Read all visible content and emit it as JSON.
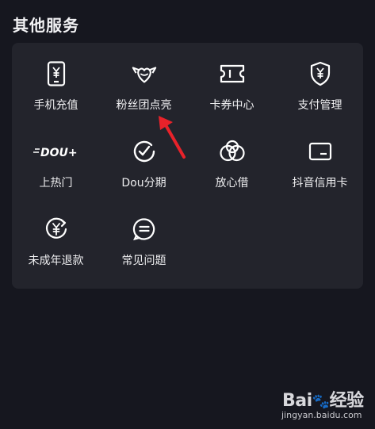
{
  "section": {
    "title": "其他服务"
  },
  "services": [
    {
      "label": "手机充值",
      "icon": "phone-recharge-icon"
    },
    {
      "label": "粉丝团点亮",
      "icon": "fan-club-icon"
    },
    {
      "label": "卡券中心",
      "icon": "coupon-icon"
    },
    {
      "label": "支付管理",
      "icon": "payment-shield-icon"
    },
    {
      "label": "上热门",
      "icon": "dou-plus-icon",
      "badge_text": "DOU+"
    },
    {
      "label": "Dou分期",
      "icon": "installment-icon"
    },
    {
      "label": "放心借",
      "icon": "loan-icon"
    },
    {
      "label": "抖音信用卡",
      "icon": "credit-card-icon"
    },
    {
      "label": "未成年退款",
      "icon": "minor-refund-icon"
    },
    {
      "label": "常见问题",
      "icon": "faq-icon"
    }
  ],
  "colors": {
    "background": "#16171f",
    "card": "#23242c",
    "annotation_arrow": "#e8222a"
  },
  "watermark": {
    "logo_text": "Bai",
    "logo_suffix": "经验",
    "url": "jingyan.baidu.com"
  }
}
